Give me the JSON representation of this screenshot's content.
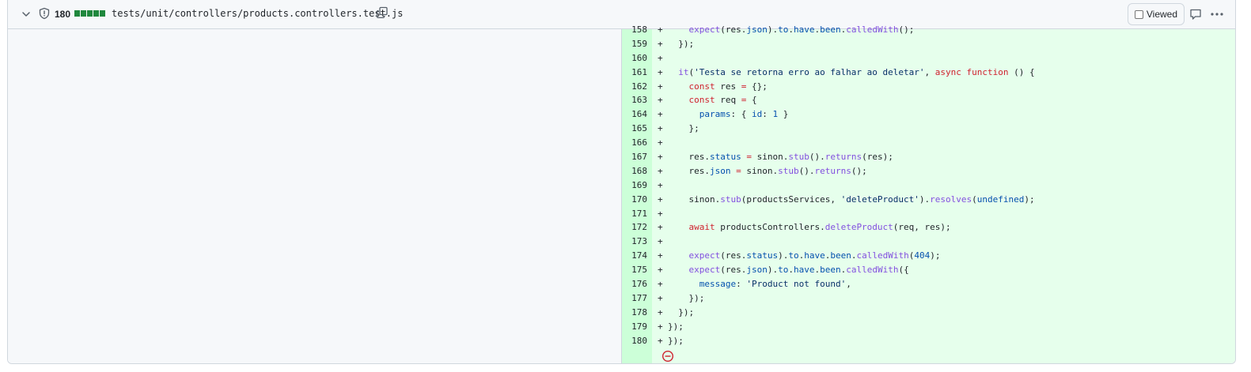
{
  "file": {
    "changes_count": "180",
    "path": "tests/unit/controllers/products.controllers.test.js",
    "viewed_label": "Viewed",
    "viewed_checked": false,
    "diffstat_blocks": 5,
    "accent_color": "#1f883d"
  },
  "icons": {
    "collapse": "chevron-down-icon",
    "security": "shield-icon",
    "copy": "copy-icon",
    "comment": "comment-icon",
    "more": "kebab-horizontal-icon",
    "no_newline": "no-entry-icon"
  },
  "diff_lines": [
    {
      "num": "158",
      "prefix": "+",
      "html": "    <span class='f'>expect</span>(res.<span class='p'>json</span>).<span class='p'>to</span>.<span class='p'>have</span>.<span class='p'>been</span>.<span class='f'>calledWith</span>();"
    },
    {
      "num": "159",
      "prefix": "+",
      "html": "  });"
    },
    {
      "num": "160",
      "prefix": "+",
      "html": ""
    },
    {
      "num": "161",
      "prefix": "+",
      "html": "  <span class='f'>it</span>(<span class='s'>'Testa se retorna erro ao falhar ao deletar'</span>, <span class='k'>async</span> <span class='k'>function</span> () {"
    },
    {
      "num": "162",
      "prefix": "+",
      "html": "    <span class='k'>const</span> res <span class='k'>=</span> {};"
    },
    {
      "num": "163",
      "prefix": "+",
      "html": "    <span class='k'>const</span> req <span class='k'>=</span> {"
    },
    {
      "num": "164",
      "prefix": "+",
      "html": "      <span class='p'>params</span>: { <span class='p'>id</span>: <span class='p'>1</span> }"
    },
    {
      "num": "165",
      "prefix": "+",
      "html": "    };"
    },
    {
      "num": "166",
      "prefix": "+",
      "html": ""
    },
    {
      "num": "167",
      "prefix": "+",
      "html": "    res.<span class='p'>status</span> <span class='k'>=</span> sinon.<span class='f'>stub</span>().<span class='f'>returns</span>(res);"
    },
    {
      "num": "168",
      "prefix": "+",
      "html": "    res.<span class='p'>json</span> <span class='k'>=</span> sinon.<span class='f'>stub</span>().<span class='f'>returns</span>();"
    },
    {
      "num": "169",
      "prefix": "+",
      "html": ""
    },
    {
      "num": "170",
      "prefix": "+",
      "html": "    sinon.<span class='f'>stub</span>(productsServices, <span class='s'>'deleteProduct'</span>).<span class='f'>resolves</span>(<span class='p'>undefined</span>);"
    },
    {
      "num": "171",
      "prefix": "+",
      "html": ""
    },
    {
      "num": "172",
      "prefix": "+",
      "html": "    <span class='k'>await</span> productsControllers.<span class='f'>deleteProduct</span>(req, res);"
    },
    {
      "num": "173",
      "prefix": "+",
      "html": ""
    },
    {
      "num": "174",
      "prefix": "+",
      "html": "    <span class='f'>expect</span>(res.<span class='p'>status</span>).<span class='p'>to</span>.<span class='p'>have</span>.<span class='p'>been</span>.<span class='f'>calledWith</span>(<span class='p'>404</span>);"
    },
    {
      "num": "175",
      "prefix": "+",
      "html": "    <span class='f'>expect</span>(res.<span class='p'>json</span>).<span class='p'>to</span>.<span class='p'>have</span>.<span class='p'>been</span>.<span class='f'>calledWith</span>({"
    },
    {
      "num": "176",
      "prefix": "+",
      "html": "      <span class='p'>message</span>: <span class='s'>'Product not found'</span>,"
    },
    {
      "num": "177",
      "prefix": "+",
      "html": "    });"
    },
    {
      "num": "178",
      "prefix": "+",
      "html": "  });"
    },
    {
      "num": "179",
      "prefix": "+",
      "html": "});"
    },
    {
      "num": "180",
      "prefix": "+",
      "html": "});"
    }
  ],
  "diff_texts": [
    "    expect(res.json).to.have.been.calledWith();",
    "  });",
    "",
    "  it('Testa se retorna erro ao falhar ao deletar', async function () {",
    "    const res = {};",
    "    const req = {",
    "      params: { id: 1 }",
    "    };",
    "",
    "    res.status = sinon.stub().returns(res);",
    "    res.json = sinon.stub().returns();",
    "",
    "    sinon.stub(productsServices, 'deleteProduct').resolves(undefined);",
    "",
    "    await productsControllers.deleteProduct(req, res);",
    "",
    "    expect(res.status).to.have.been.calledWith(404);",
    "    expect(res.json).to.have.been.calledWith({",
    "      message: 'Product not found',",
    "    });",
    "  });",
    "});",
    "});"
  ]
}
